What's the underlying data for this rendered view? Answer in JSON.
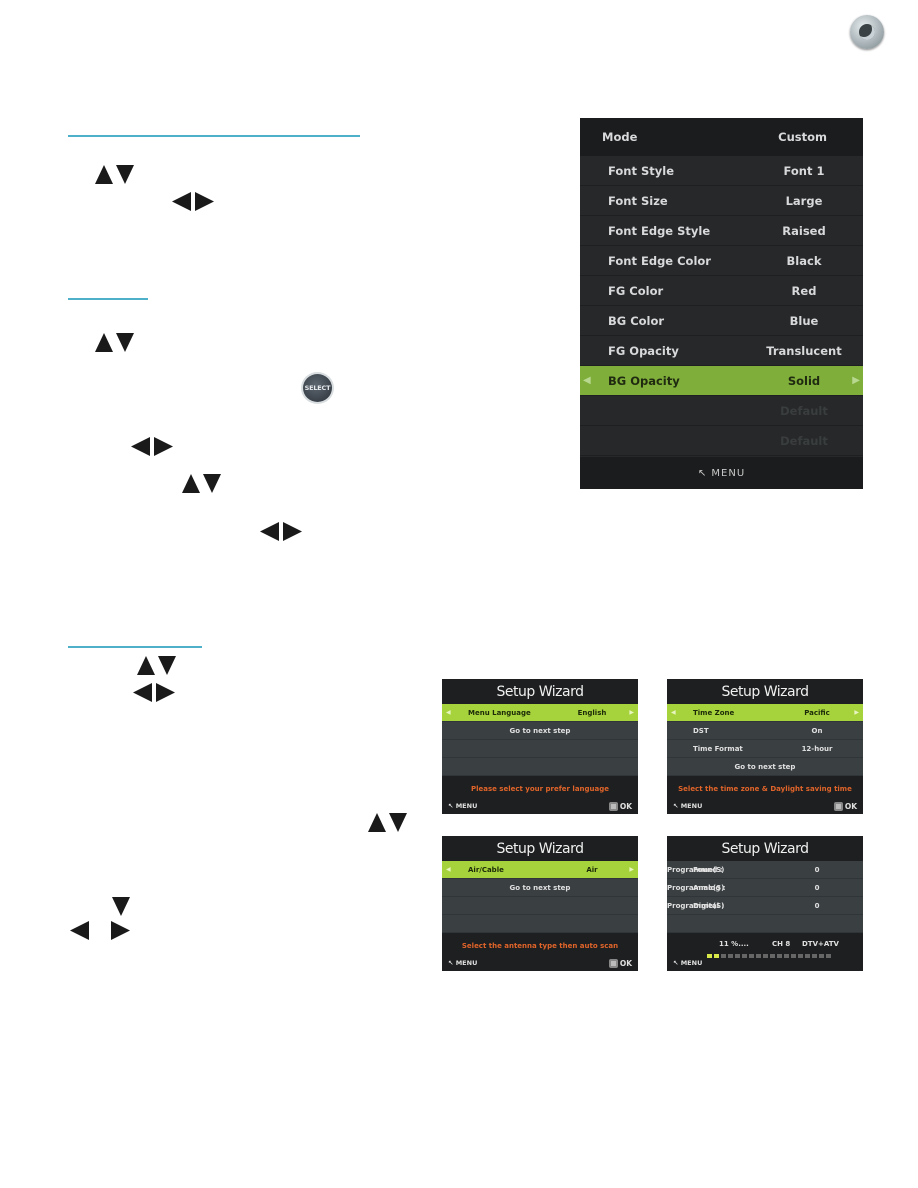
{
  "page_icon": "page-marker-icon",
  "select_button_label": "SELECT",
  "tv_menu": {
    "header": {
      "label": "Mode",
      "value": "Custom"
    },
    "rows": [
      {
        "label": "Font Style",
        "value": "Font 1"
      },
      {
        "label": "Font Size",
        "value": "Large"
      },
      {
        "label": "Font Edge Style",
        "value": "Raised"
      },
      {
        "label": "Font Edge Color",
        "value": "Black"
      },
      {
        "label": "FG Color",
        "value": "Red"
      },
      {
        "label": "BG Color",
        "value": "Blue"
      },
      {
        "label": "FG Opacity",
        "value": "Translucent"
      },
      {
        "label": "BG Opacity",
        "value": "Solid"
      },
      {
        "label": "",
        "value": "Default"
      },
      {
        "label": "",
        "value": "Default"
      }
    ],
    "selected_index": 7,
    "footer": "MENU",
    "highlight_color": "#7fae3a"
  },
  "wizards": {
    "title": "Setup Wizard",
    "menu": "MENU",
    "ok": "OK",
    "language": {
      "row": {
        "label": "Menu Language",
        "value": "English"
      },
      "next": "Go to next step",
      "message": "Please select your prefer language"
    },
    "time": {
      "rows": [
        {
          "label": "Time Zone",
          "value": "Pacific"
        },
        {
          "label": "DST",
          "value": "On"
        },
        {
          "label": "Time Format",
          "value": "12-hour"
        }
      ],
      "next": "Go to next step",
      "message": "Select the time zone & Daylight saving time"
    },
    "antenna": {
      "row": {
        "label": "Air/Cable",
        "value": "Air"
      },
      "next": "Go to next step",
      "message": "Select the antenna type then auto scan"
    },
    "scan": {
      "rows": [
        {
          "label": "Found :",
          "value": "0",
          "unit": "Programme(S)"
        },
        {
          "label": "Analog :",
          "value": "0",
          "unit": "Programme(S)"
        },
        {
          "label": "Digital :",
          "value": "0",
          "unit": "Programme(S)"
        }
      ],
      "progress": "11 %....",
      "channel": "CH 8",
      "type": "DTV+ATV",
      "progress_percent": 11
    },
    "accent_color": "#a6d33c",
    "message_color": "#e0642a"
  }
}
